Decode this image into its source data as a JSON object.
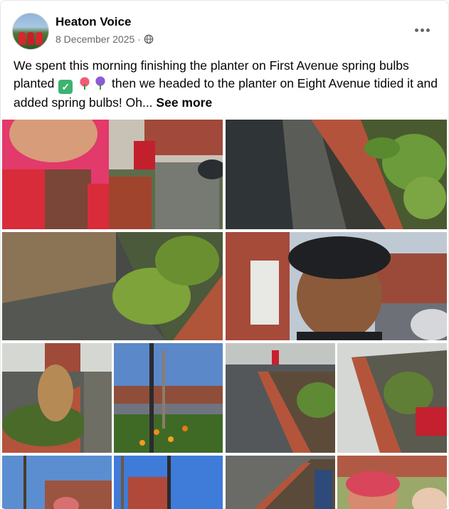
{
  "post": {
    "page_name": "Heaton Voice",
    "date": "8 December 2025",
    "separator": "·",
    "privacy_icon": "globe-icon",
    "more_icon": "more-options-icon",
    "text_part1": "We spent this morning finishing the planter on First Avenue spring bulbs planted",
    "text_part2": "then we headed to the planter on Eight Avenue tidied it and added spring bulbs! Oh...",
    "see_more": "See more",
    "emojis": [
      "check-mark-emoji",
      "tulip-emoji",
      "hyacinth-emoji"
    ]
  },
  "photos": [
    {
      "name": "photo-selfie-woman-planter",
      "subject": "selfie woman in pink jacket by planter"
    },
    {
      "name": "photo-planter-wall-closeup",
      "subject": "brick planter wall and path"
    },
    {
      "name": "photo-tidied-planter-fence",
      "subject": "tidied planter beside wooden fence"
    },
    {
      "name": "photo-selfie-man-cap",
      "subject": "selfie man in black cap on street"
    },
    {
      "name": "photo-planter-grasses",
      "subject": "planter with grasses"
    },
    {
      "name": "photo-street-lamp-flowers",
      "subject": "street lamp with orange flowers"
    },
    {
      "name": "photo-planter-volunteers",
      "subject": "volunteers working on planter"
    },
    {
      "name": "photo-planter-tools",
      "subject": "planter with tools and bags"
    },
    {
      "name": "photo-street-trees",
      "subject": "street with trees and blue sky"
    },
    {
      "name": "photo-lamp-post-sky",
      "subject": "lamp post and houses"
    },
    {
      "name": "photo-planter-bench",
      "subject": "planter with bench"
    },
    {
      "name": "photo-selfie-group",
      "subject": "group selfie"
    }
  ]
}
